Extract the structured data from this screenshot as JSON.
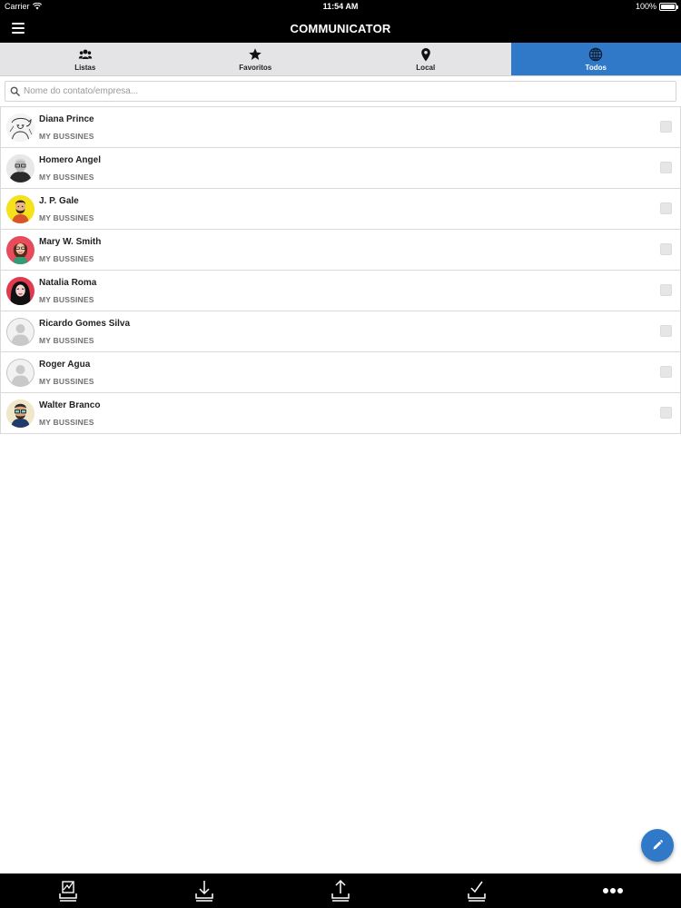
{
  "status_bar": {
    "carrier": "Carrier",
    "time": "11:54 AM",
    "battery": "100%"
  },
  "header": {
    "title": "COMMUNICATOR"
  },
  "tabs": [
    {
      "label": "Listas",
      "icon": "people-icon",
      "active": false
    },
    {
      "label": "Favoritos",
      "icon": "star-icon",
      "active": false
    },
    {
      "label": "Local",
      "icon": "location-pin-icon",
      "active": false
    },
    {
      "label": "Todos",
      "icon": "globe-icon",
      "active": true
    }
  ],
  "search": {
    "placeholder": "Nome do contato/empresa...",
    "value": ""
  },
  "contacts": [
    {
      "name": "Diana Prince",
      "company": "MY BUSSINES"
    },
    {
      "name": "Homero Angel",
      "company": "MY BUSSINES"
    },
    {
      "name": "J. P. Gale",
      "company": "MY BUSSINES"
    },
    {
      "name": "Mary W. Smith",
      "company": "MY BUSSINES"
    },
    {
      "name": "Natalia Roma",
      "company": "MY BUSSINES"
    },
    {
      "name": "Ricardo Gomes Silva",
      "company": "MY BUSSINES"
    },
    {
      "name": "Roger Agua",
      "company": "MY BUSSINES"
    },
    {
      "name": "Walter Branco",
      "company": "MY BUSSINES"
    }
  ],
  "fab": {
    "icon": "pencil-icon"
  },
  "bottom_toolbar": [
    {
      "icon": "sign-document-icon"
    },
    {
      "icon": "download-icon"
    },
    {
      "icon": "upload-icon"
    },
    {
      "icon": "checkmark-tray-icon"
    },
    {
      "icon": "more-dots-icon"
    }
  ],
  "colors": {
    "accent": "#2f79c8",
    "bar_background": "#000000",
    "tab_background": "#e4e4e6"
  }
}
